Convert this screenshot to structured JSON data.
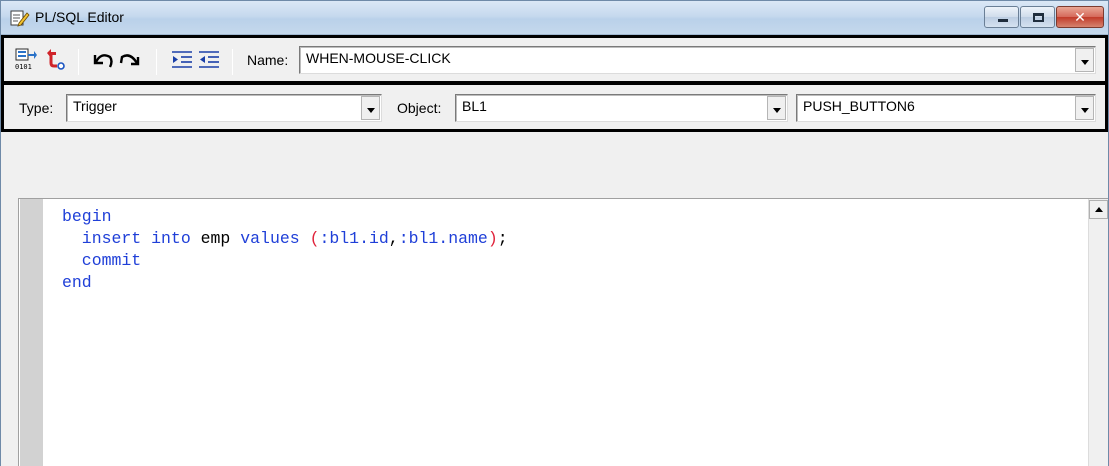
{
  "window": {
    "title": "PL/SQL Editor",
    "icon": "pencil-document-icon"
  },
  "toolbar": {
    "compile_icon": "compile-icon",
    "revert_icon": "revert-icon",
    "undo_icon": "undo-icon",
    "redo_icon": "redo-icon",
    "indent_icon": "indent-icon",
    "outdent_icon": "outdent-icon",
    "name_label": "Name:",
    "name_value": "WHEN-MOUSE-CLICK"
  },
  "filters": {
    "type_label": "Type:",
    "type_value": "Trigger",
    "object_label": "Object:",
    "object_value": "BL1",
    "item_value": "PUSH_BUTTON6"
  },
  "editor": {
    "lines": [
      [
        {
          "text": "begin",
          "kind": "kw"
        }
      ],
      [
        {
          "text": "  insert into ",
          "kind": "kw"
        },
        {
          "text": "emp",
          "kind": "plain"
        },
        {
          "text": " values ",
          "kind": "kw"
        },
        {
          "text": "(",
          "kind": "paren"
        },
        {
          "text": ":bl1.id",
          "kind": "kw"
        },
        {
          "text": ",",
          "kind": "plain"
        },
        {
          "text": ":bl1.name",
          "kind": "kw"
        },
        {
          "text": ")",
          "kind": "paren"
        },
        {
          "text": ";",
          "kind": "plain"
        }
      ],
      [
        {
          "text": "  commit",
          "kind": "kw"
        }
      ],
      [
        {
          "text": "end",
          "kind": "kw"
        }
      ]
    ]
  },
  "colors": {
    "keyword": "#1f3fd8",
    "paren": "#e0233b"
  }
}
